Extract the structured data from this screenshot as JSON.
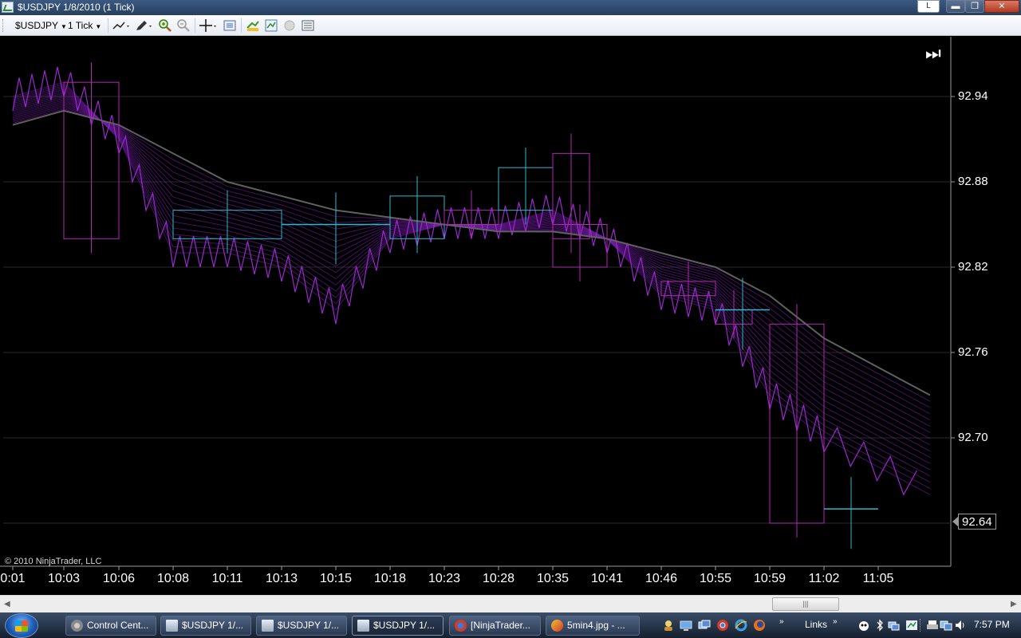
{
  "window": {
    "title": "$USDJPY  1/8/2010 (1 Tick)",
    "caption_l": "L",
    "caption_min": "▬",
    "caption_max": "❐",
    "caption_close": "✕"
  },
  "toolbar": {
    "instrument": "$USDJPY",
    "interval": "1 Tick",
    "icons": [
      "line-tool-icon",
      "pencil-icon",
      "zoom-in-icon",
      "zoom-out-icon",
      "crosshair-icon",
      "data-box-icon",
      "bar-color-icon",
      "indicators-icon",
      "circle-icon",
      "properties-icon"
    ]
  },
  "chart": {
    "price_labels": [
      "92.94",
      "92.88",
      "92.82",
      "92.76",
      "92.70"
    ],
    "last_price": "92.64",
    "time_labels": [
      "0:01",
      "10:03",
      "10:06",
      "10:08",
      "10:11",
      "10:13",
      "10:15",
      "10:18",
      "10:23",
      "10:28",
      "10:35",
      "10:41",
      "10:46",
      "10:55",
      "10:59",
      "11:02",
      "11:05"
    ],
    "copyright": "© 2010 NinjaTrader, LLC",
    "jump_to_end": "⏭",
    "colors": {
      "background": "#000000",
      "up_box": "#2fb9c8",
      "down_box": "#b02ab0",
      "ribbon": "#7a1fb0",
      "slow_ma": "#606060"
    }
  },
  "chart_data": {
    "type": "line",
    "title": "",
    "xlabel": "",
    "ylabel": "",
    "ylim": [
      92.61,
      92.98
    ],
    "x": [
      "0:01",
      "10:03",
      "10:06",
      "10:08",
      "10:11",
      "10:13",
      "10:15",
      "10:18",
      "10:23",
      "10:28",
      "10:35",
      "10:41",
      "10:46",
      "10:55",
      "10:59",
      "11:02",
      "11:05"
    ],
    "series": [
      {
        "values": [
          92.92,
          92.93,
          92.92,
          92.9,
          92.88,
          92.87,
          92.86,
          92.855,
          92.85,
          92.845,
          92.845,
          92.84,
          92.83,
          92.82,
          92.8,
          92.77,
          92.73
        ]
      },
      {
        "values": [
          92.94,
          92.95,
          92.91,
          92.83,
          92.83,
          92.82,
          92.79,
          92.84,
          92.85,
          92.85,
          92.86,
          92.84,
          92.8,
          92.79,
          92.73,
          92.7,
          92.66
        ]
      }
    ],
    "boxes": [
      {
        "start": "10:03",
        "end": "10:06",
        "open": 92.95,
        "close": 92.84,
        "direction": "down"
      },
      {
        "start": "10:08",
        "end": "10:13",
        "open": 92.84,
        "close": 92.86,
        "direction": "up"
      },
      {
        "start": "10:13",
        "end": "10:18",
        "open": 92.85,
        "close": 92.85,
        "direction": "flat"
      },
      {
        "start": "10:18",
        "end": "10:23",
        "open": 92.84,
        "close": 92.87,
        "direction": "up"
      },
      {
        "start": "10:23",
        "end": "10:28",
        "open": 92.86,
        "close": 92.85,
        "direction": "down"
      },
      {
        "start": "10:28",
        "end": "10:35",
        "open": 92.86,
        "close": 92.89,
        "direction": "up"
      },
      {
        "start": "10:35",
        "end": "10:35",
        "open": 92.9,
        "close": 92.84,
        "direction": "down"
      },
      {
        "start": "10:35",
        "end": "10:41",
        "open": 92.85,
        "close": 92.82,
        "direction": "down"
      },
      {
        "start": "10:46",
        "end": "10:55",
        "open": 92.81,
        "close": 92.8,
        "direction": "down"
      },
      {
        "start": "10:55",
        "end": "10:55",
        "open": 92.79,
        "close": 92.78,
        "direction": "down"
      },
      {
        "start": "10:55",
        "end": "10:59",
        "open": 92.79,
        "close": 92.79,
        "direction": "flat"
      },
      {
        "start": "10:59",
        "end": "11:02",
        "open": 92.78,
        "close": 92.64,
        "direction": "down"
      },
      {
        "start": "11:02",
        "end": "11:05",
        "open": 92.65,
        "close": 92.65,
        "direction": "flat"
      }
    ]
  },
  "scrollbar": {
    "left_arrow": "◀",
    "right_arrow": "▶",
    "thumb_grip": "|||"
  },
  "taskbar": {
    "tasks": [
      {
        "label": "Control Cent...",
        "icon": "gear-icon",
        "active": false
      },
      {
        "label": "$USDJPY  1/...",
        "icon": "chart-icon",
        "active": false
      },
      {
        "label": "$USDJPY  1/...",
        "icon": "chart-icon",
        "active": false
      },
      {
        "label": "$USDJPY  1/...",
        "icon": "chart-icon",
        "active": true
      },
      {
        "label": "[NinjaTrader...",
        "icon": "chrome-icon",
        "active": false
      },
      {
        "label": "5min4.jpg - ...",
        "icon": "paint-icon",
        "active": false
      }
    ],
    "links": "Links",
    "clock": "7:57 PM"
  }
}
